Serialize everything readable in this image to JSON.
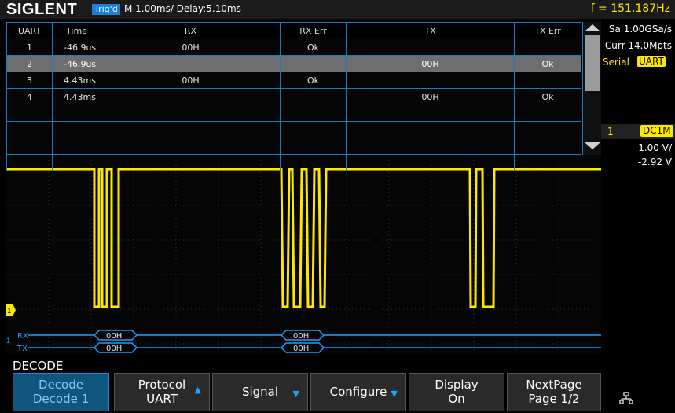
{
  "header": {
    "logo": "SIGLENT",
    "trigger_status": "Trig'd",
    "timebase": "M 1.00ms/ Delay:5.10ms",
    "frequency": "f = 151.187Hz"
  },
  "table": {
    "columns": [
      "UART",
      "Time",
      "RX",
      "RX Err",
      "TX",
      "TX Err"
    ],
    "rows": [
      {
        "uart": "1",
        "time": "-46.9us",
        "rx": "00H",
        "rx_err": "Ok",
        "tx": "",
        "tx_err": ""
      },
      {
        "uart": "2",
        "time": "-46.9us",
        "rx": "",
        "rx_err": "",
        "tx": "00H",
        "tx_err": "Ok"
      },
      {
        "uart": "3",
        "time": "4.43ms",
        "rx": "00H",
        "rx_err": "Ok",
        "tx": "",
        "tx_err": ""
      },
      {
        "uart": "4",
        "time": "4.43ms",
        "rx": "",
        "rx_err": "",
        "tx": "00H",
        "tx_err": "Ok"
      }
    ],
    "selected_row": 2
  },
  "right_panel": {
    "sample_rate": "Sa 1.00GSa/s",
    "memory": "Curr 14.0Mpts",
    "serial_label": "Serial",
    "serial_badge": "UART",
    "channel_number": "1",
    "coupling": "DC1M",
    "volts_div": "1.00 V/",
    "offset": "-2.92 V"
  },
  "bus": {
    "marker": "S1",
    "rx_label": "RX",
    "tx_label": "TX",
    "packets": [
      "00H",
      "00H"
    ],
    "channel_marker": "1"
  },
  "menu": {
    "title": "DECODE",
    "buttons": [
      {
        "line1": "Decode",
        "line2": "Decode 1",
        "arrow": ""
      },
      {
        "line1": "Protocol",
        "line2": "UART",
        "arrow": "up"
      },
      {
        "line1": "Signal",
        "line2": "",
        "arrow": "down"
      },
      {
        "line1": "Configure",
        "line2": "",
        "arrow": "down"
      },
      {
        "line1": "Display",
        "line2": "On",
        "arrow": ""
      },
      {
        "line1": "NextPage",
        "line2": "Page 1/2",
        "arrow": ""
      }
    ]
  },
  "colors": {
    "channel1": "#ffe800",
    "accent": "#1e7fd8",
    "grid": "#3a3a3a",
    "table_border": "#1c7ac0"
  },
  "icons": [
    "scroll-up-icon",
    "scroll-down-icon",
    "network-icon",
    "trigger-arrow-icon"
  ]
}
